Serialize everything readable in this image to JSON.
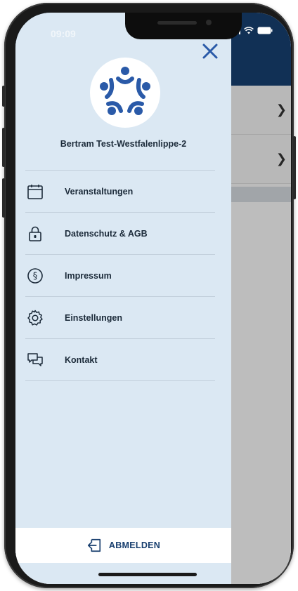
{
  "status_bar": {
    "time": "09:09"
  },
  "drawer": {
    "user_name": "Bertram Test-Westfalenlippe-2",
    "menu_items": [
      {
        "label": "Veranstaltungen",
        "icon": "calendar-icon"
      },
      {
        "label": "Datenschutz & AGB",
        "icon": "lock-icon"
      },
      {
        "label": "Impressum",
        "icon": "paragraph-icon"
      },
      {
        "label": "Einstellungen",
        "icon": "gear-icon"
      },
      {
        "label": "Kontakt",
        "icon": "chat-icon"
      }
    ],
    "logout_label": "ABMELDEN"
  },
  "colors": {
    "drawer_bg": "#dbe8f3",
    "accent": "#173e6e",
    "logo_blue": "#2a5aa8"
  }
}
